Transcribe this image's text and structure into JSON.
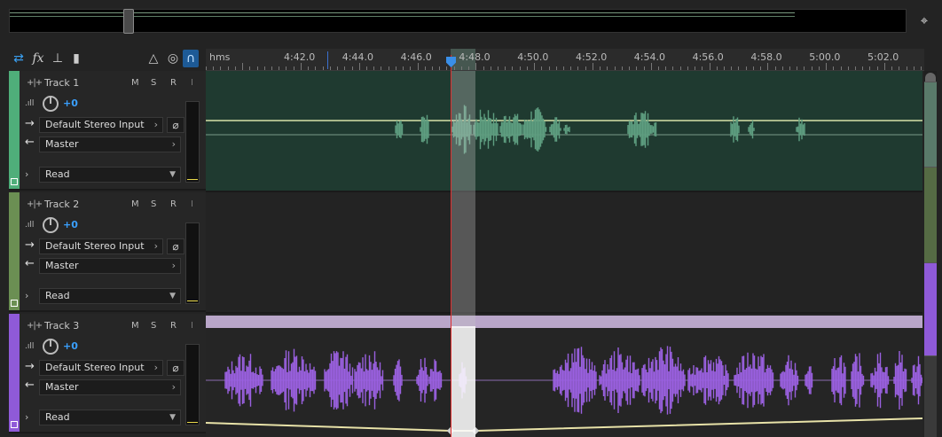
{
  "ruler": {
    "unit": "hms",
    "labels": [
      "4:42.0",
      "4:44.0",
      "4:46.0",
      "4:48.0",
      "4:50.0",
      "4:52.0",
      "4:54.0",
      "4:56.0",
      "4:58.0",
      "5:00.0",
      "5:02.0"
    ]
  },
  "tracks": [
    {
      "name": "Track 1",
      "mute": "M",
      "solo": "S",
      "record": "R",
      "input_monitor": "I",
      "volume": "+0",
      "input": "Default Stereo Input",
      "output": "Master",
      "automation": "Read",
      "color": "#4fae7a"
    },
    {
      "name": "Track 2",
      "mute": "M",
      "solo": "S",
      "record": "R",
      "input_monitor": "I",
      "volume": "+0",
      "input": "Default Stereo Input",
      "output": "Master",
      "automation": "Read",
      "color": "#6b8f53"
    },
    {
      "name": "Track 3",
      "mute": "M",
      "solo": "S",
      "record": "R",
      "input_monitor": "I",
      "volume": "+0",
      "input": "Default Stereo Input",
      "output": "Master",
      "automation": "Read",
      "color": "#8f5ad8"
    }
  ],
  "colors": {
    "playhead": "#e03030",
    "accent": "#3a9ff0",
    "track1_wave": "#5e9e80",
    "track3_wave": "#9a60e0"
  }
}
